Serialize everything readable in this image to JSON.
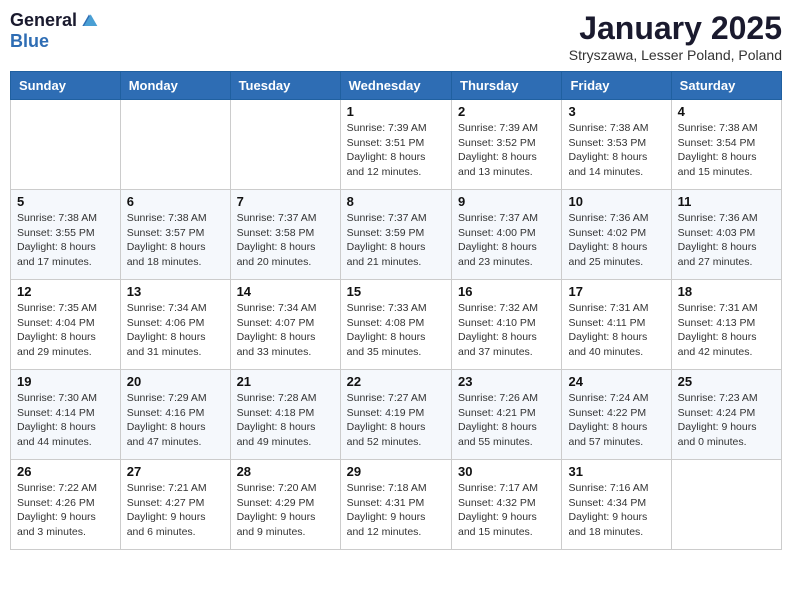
{
  "logo": {
    "general": "General",
    "blue": "Blue"
  },
  "title": "January 2025",
  "subtitle": "Stryszawa, Lesser Poland, Poland",
  "headers": [
    "Sunday",
    "Monday",
    "Tuesday",
    "Wednesday",
    "Thursday",
    "Friday",
    "Saturday"
  ],
  "weeks": [
    [
      {
        "day": "",
        "info": ""
      },
      {
        "day": "",
        "info": ""
      },
      {
        "day": "",
        "info": ""
      },
      {
        "day": "1",
        "info": "Sunrise: 7:39 AM\nSunset: 3:51 PM\nDaylight: 8 hours\nand 12 minutes."
      },
      {
        "day": "2",
        "info": "Sunrise: 7:39 AM\nSunset: 3:52 PM\nDaylight: 8 hours\nand 13 minutes."
      },
      {
        "day": "3",
        "info": "Sunrise: 7:38 AM\nSunset: 3:53 PM\nDaylight: 8 hours\nand 14 minutes."
      },
      {
        "day": "4",
        "info": "Sunrise: 7:38 AM\nSunset: 3:54 PM\nDaylight: 8 hours\nand 15 minutes."
      }
    ],
    [
      {
        "day": "5",
        "info": "Sunrise: 7:38 AM\nSunset: 3:55 PM\nDaylight: 8 hours\nand 17 minutes."
      },
      {
        "day": "6",
        "info": "Sunrise: 7:38 AM\nSunset: 3:57 PM\nDaylight: 8 hours\nand 18 minutes."
      },
      {
        "day": "7",
        "info": "Sunrise: 7:37 AM\nSunset: 3:58 PM\nDaylight: 8 hours\nand 20 minutes."
      },
      {
        "day": "8",
        "info": "Sunrise: 7:37 AM\nSunset: 3:59 PM\nDaylight: 8 hours\nand 21 minutes."
      },
      {
        "day": "9",
        "info": "Sunrise: 7:37 AM\nSunset: 4:00 PM\nDaylight: 8 hours\nand 23 minutes."
      },
      {
        "day": "10",
        "info": "Sunrise: 7:36 AM\nSunset: 4:02 PM\nDaylight: 8 hours\nand 25 minutes."
      },
      {
        "day": "11",
        "info": "Sunrise: 7:36 AM\nSunset: 4:03 PM\nDaylight: 8 hours\nand 27 minutes."
      }
    ],
    [
      {
        "day": "12",
        "info": "Sunrise: 7:35 AM\nSunset: 4:04 PM\nDaylight: 8 hours\nand 29 minutes."
      },
      {
        "day": "13",
        "info": "Sunrise: 7:34 AM\nSunset: 4:06 PM\nDaylight: 8 hours\nand 31 minutes."
      },
      {
        "day": "14",
        "info": "Sunrise: 7:34 AM\nSunset: 4:07 PM\nDaylight: 8 hours\nand 33 minutes."
      },
      {
        "day": "15",
        "info": "Sunrise: 7:33 AM\nSunset: 4:08 PM\nDaylight: 8 hours\nand 35 minutes."
      },
      {
        "day": "16",
        "info": "Sunrise: 7:32 AM\nSunset: 4:10 PM\nDaylight: 8 hours\nand 37 minutes."
      },
      {
        "day": "17",
        "info": "Sunrise: 7:31 AM\nSunset: 4:11 PM\nDaylight: 8 hours\nand 40 minutes."
      },
      {
        "day": "18",
        "info": "Sunrise: 7:31 AM\nSunset: 4:13 PM\nDaylight: 8 hours\nand 42 minutes."
      }
    ],
    [
      {
        "day": "19",
        "info": "Sunrise: 7:30 AM\nSunset: 4:14 PM\nDaylight: 8 hours\nand 44 minutes."
      },
      {
        "day": "20",
        "info": "Sunrise: 7:29 AM\nSunset: 4:16 PM\nDaylight: 8 hours\nand 47 minutes."
      },
      {
        "day": "21",
        "info": "Sunrise: 7:28 AM\nSunset: 4:18 PM\nDaylight: 8 hours\nand 49 minutes."
      },
      {
        "day": "22",
        "info": "Sunrise: 7:27 AM\nSunset: 4:19 PM\nDaylight: 8 hours\nand 52 minutes."
      },
      {
        "day": "23",
        "info": "Sunrise: 7:26 AM\nSunset: 4:21 PM\nDaylight: 8 hours\nand 55 minutes."
      },
      {
        "day": "24",
        "info": "Sunrise: 7:24 AM\nSunset: 4:22 PM\nDaylight: 8 hours\nand 57 minutes."
      },
      {
        "day": "25",
        "info": "Sunrise: 7:23 AM\nSunset: 4:24 PM\nDaylight: 9 hours\nand 0 minutes."
      }
    ],
    [
      {
        "day": "26",
        "info": "Sunrise: 7:22 AM\nSunset: 4:26 PM\nDaylight: 9 hours\nand 3 minutes."
      },
      {
        "day": "27",
        "info": "Sunrise: 7:21 AM\nSunset: 4:27 PM\nDaylight: 9 hours\nand 6 minutes."
      },
      {
        "day": "28",
        "info": "Sunrise: 7:20 AM\nSunset: 4:29 PM\nDaylight: 9 hours\nand 9 minutes."
      },
      {
        "day": "29",
        "info": "Sunrise: 7:18 AM\nSunset: 4:31 PM\nDaylight: 9 hours\nand 12 minutes."
      },
      {
        "day": "30",
        "info": "Sunrise: 7:17 AM\nSunset: 4:32 PM\nDaylight: 9 hours\nand 15 minutes."
      },
      {
        "day": "31",
        "info": "Sunrise: 7:16 AM\nSunset: 4:34 PM\nDaylight: 9 hours\nand 18 minutes."
      },
      {
        "day": "",
        "info": ""
      }
    ]
  ]
}
